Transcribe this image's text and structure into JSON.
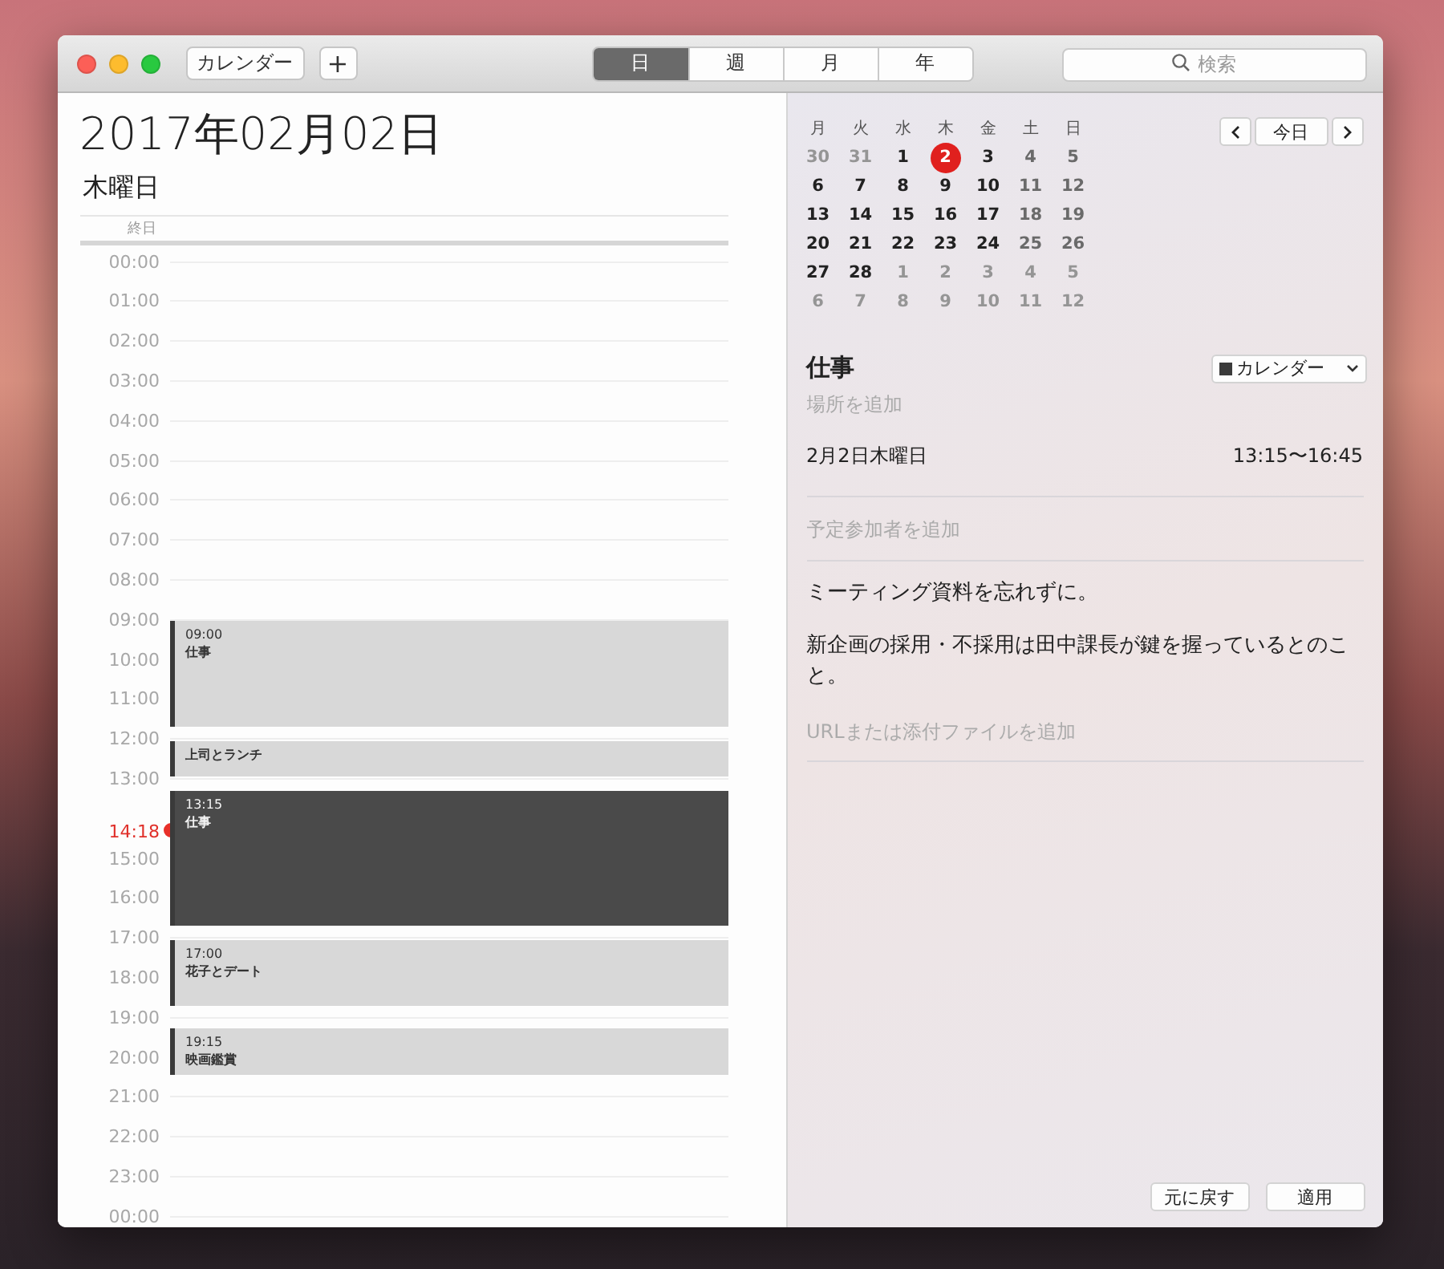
{
  "toolbar": {
    "calendars_button": "カレンダー",
    "add_button": "+",
    "search": {
      "placeholder": "検索"
    }
  },
  "tabs": [
    {
      "label": "日",
      "selected": true
    },
    {
      "label": "週",
      "selected": false
    },
    {
      "label": "月",
      "selected": false
    },
    {
      "label": "年",
      "selected": false
    }
  ],
  "day": {
    "date": "2017年02月02日",
    "weekday": "木曜日",
    "all_day_label": "終日",
    "hours": [
      {
        "label": "00:00",
        "kind": "hour"
      },
      {
        "label": "01:00",
        "kind": "hour"
      },
      {
        "label": "02:00",
        "kind": "hour"
      },
      {
        "label": "03:00",
        "kind": "hour"
      },
      {
        "label": "04:00",
        "kind": "hour"
      },
      {
        "label": "05:00",
        "kind": "hour"
      },
      {
        "label": "06:00",
        "kind": "hour"
      },
      {
        "label": "07:00",
        "kind": "hour"
      },
      {
        "label": "08:00",
        "kind": "hour"
      },
      {
        "label": "09:00",
        "kind": "hour"
      },
      {
        "label": "10:00",
        "kind": "hour"
      },
      {
        "label": "11:00",
        "kind": "hour"
      },
      {
        "label": "12:00",
        "kind": "hour"
      },
      {
        "label": "13:00",
        "kind": "hour"
      },
      {
        "label": "14:18",
        "kind": "now"
      },
      {
        "label": "15:00",
        "kind": "hour"
      },
      {
        "label": "16:00",
        "kind": "hour"
      },
      {
        "label": "17:00",
        "kind": "hour"
      },
      {
        "label": "18:00",
        "kind": "hour"
      },
      {
        "label": "19:00",
        "kind": "hour"
      },
      {
        "label": "20:00",
        "kind": "hour"
      },
      {
        "label": "21:00",
        "kind": "hour"
      },
      {
        "label": "22:00",
        "kind": "hour"
      },
      {
        "label": "23:00",
        "kind": "hour"
      },
      {
        "label": "00:00",
        "kind": "hour"
      }
    ],
    "events": [
      {
        "time": "09:00",
        "title": "仕事",
        "selected": false
      },
      {
        "title": "上司とランチ",
        "selected": false
      },
      {
        "time": "13:15",
        "title": "仕事",
        "selected": true
      },
      {
        "time": "17:00",
        "title": "花子とデート",
        "selected": false
      },
      {
        "time": "19:15",
        "title": "映画鑑賞",
        "selected": false
      }
    ]
  },
  "mini_calendar": {
    "weekdays": [
      "月",
      "火",
      "水",
      "木",
      "金",
      "土",
      "日"
    ],
    "weeks": [
      [
        {
          "day": "30",
          "current_month": false,
          "selected": false
        },
        {
          "day": "31",
          "current_month": false,
          "selected": false
        },
        {
          "day": "1",
          "current_month": true,
          "selected": false
        },
        {
          "day": "2",
          "current_month": true,
          "selected": true
        },
        {
          "day": "3",
          "current_month": true,
          "selected": false
        },
        {
          "day": "4",
          "current_month": true,
          "selected": false
        },
        {
          "day": "5",
          "current_month": true,
          "selected": false
        }
      ],
      [
        {
          "day": "6",
          "current_month": true,
          "selected": false
        },
        {
          "day": "7",
          "current_month": true,
          "selected": false
        },
        {
          "day": "8",
          "current_month": true,
          "selected": false
        },
        {
          "day": "9",
          "current_month": true,
          "selected": false
        },
        {
          "day": "10",
          "current_month": true,
          "selected": false
        },
        {
          "day": "11",
          "current_month": true,
          "selected": false
        },
        {
          "day": "12",
          "current_month": true,
          "selected": false
        }
      ],
      [
        {
          "day": "13",
          "current_month": true,
          "selected": false
        },
        {
          "day": "14",
          "current_month": true,
          "selected": false
        },
        {
          "day": "15",
          "current_month": true,
          "selected": false
        },
        {
          "day": "16",
          "current_month": true,
          "selected": false
        },
        {
          "day": "17",
          "current_month": true,
          "selected": false
        },
        {
          "day": "18",
          "current_month": true,
          "selected": false
        },
        {
          "day": "19",
          "current_month": true,
          "selected": false
        }
      ],
      [
        {
          "day": "20",
          "current_month": true,
          "selected": false
        },
        {
          "day": "21",
          "current_month": true,
          "selected": false
        },
        {
          "day": "22",
          "current_month": true,
          "selected": false
        },
        {
          "day": "23",
          "current_month": true,
          "selected": false
        },
        {
          "day": "24",
          "current_month": true,
          "selected": false
        },
        {
          "day": "25",
          "current_month": true,
          "selected": false
        },
        {
          "day": "26",
          "current_month": true,
          "selected": false
        }
      ],
      [
        {
          "day": "27",
          "current_month": true,
          "selected": false
        },
        {
          "day": "28",
          "current_month": true,
          "selected": false
        },
        {
          "day": "1",
          "current_month": false,
          "selected": false
        },
        {
          "day": "2",
          "current_month": false,
          "selected": false
        },
        {
          "day": "3",
          "current_month": false,
          "selected": false
        },
        {
          "day": "4",
          "current_month": false,
          "selected": false
        },
        {
          "day": "5",
          "current_month": false,
          "selected": false
        }
      ],
      [
        {
          "day": "6",
          "current_month": false,
          "selected": false
        },
        {
          "day": "7",
          "current_month": false,
          "selected": false
        },
        {
          "day": "8",
          "current_month": false,
          "selected": false
        },
        {
          "day": "9",
          "current_month": false,
          "selected": false
        },
        {
          "day": "10",
          "current_month": false,
          "selected": false
        },
        {
          "day": "11",
          "current_month": false,
          "selected": false
        },
        {
          "day": "12",
          "current_month": false,
          "selected": false
        }
      ]
    ],
    "today_button": "今日"
  },
  "detail": {
    "title": "仕事",
    "calendar": {
      "label": "カレンダー",
      "color": "#3a3a3a"
    },
    "location": {
      "placeholder": "場所を追加"
    },
    "date": "2月2日木曜日",
    "time": "13:15〜16:45",
    "invitees": {
      "placeholder": "予定参加者を追加"
    },
    "notes": [
      "ミーティング資料を忘れずに。",
      "新企画の採用・不採用は田中課長が鍵を握っているとのこと。"
    ],
    "attachments": {
      "placeholder": "URLまたは添付ファイルを追加"
    },
    "buttons": [
      "元に戻す",
      "適用"
    ]
  }
}
